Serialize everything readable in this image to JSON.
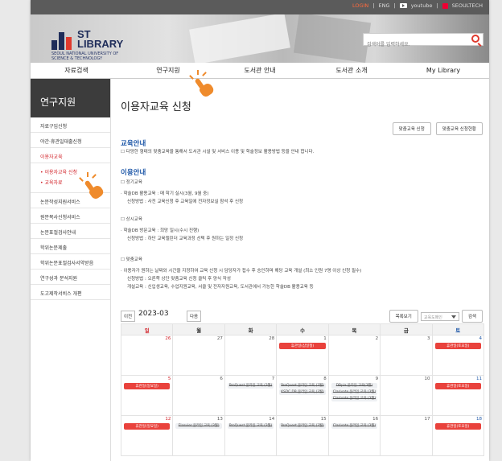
{
  "topbar": {
    "login": "LOGIN",
    "eng": "ENG",
    "youtube": "youtube",
    "seoultech": "SEOULTECH"
  },
  "logo": {
    "st": "ST",
    "library": "LIBRARY",
    "sub1": "SEOUL NATIONAL UNIVERSITY OF",
    "sub2": "SCIENCE & TECHNOLOGY"
  },
  "search": {
    "placeholder": "검색어를 입력하세요."
  },
  "nav": [
    "자료검색",
    "연구지원",
    "도서관 안내",
    "도서관 소개",
    "My Library"
  ],
  "sidebar": {
    "title": "연구지원",
    "items": [
      "자료구입신청",
      "야간·휴관일대출신청",
      "이용자교육"
    ],
    "subitems": [
      "이용자교육 신청",
      "교육자료"
    ],
    "items2": [
      "논문작성지원서비스",
      "원문복사신청서비스",
      "논문표절검사안내",
      "학위논문제출",
      "학위논문표절검사서약받음",
      "연구성과 분석지원",
      "도고제작서비스 개편"
    ]
  },
  "main": {
    "title": "이용자교육 신청",
    "buttons": [
      "맞춤교육 신청",
      "맞춤교육 신청현황"
    ],
    "edu_title": "교육안내",
    "edu_text": "☐ 다양한 형태의 맞춤교육을 통해서 도서관 시설 및 서비스 이용 및 학술정보 활용방법 등을 안내 합니다.",
    "use_title": "이용안내",
    "s1_head": "☐ 정기교육",
    "s1_l1": "· 학술DB 활용교육 : 매 학기 실시(3월, 9월 중)",
    "s1_l2": "신청방법 : 사전 교육신청 후 교육일에 전자정보실 참석 후 신청",
    "s2_head": "☐ 상시교육",
    "s2_l1": "· 학술DB 방문교육 : 희망 일시(수시 진행)",
    "s2_l2": "신청방법 : 하단 교육캘린더 교육과정 선택 후 원하는 일정 신청",
    "s3_head": "☐ 맞춤교육",
    "s3_l1": "· 이용자가 원하는 날짜와 시간을 지정하여 교육 신청 시 담당자가 접수 후 승인하며 해당 교육 개설 (최소 인원 7명 이상 신청 필수)",
    "s3_l2": "신청방법 : 오른쪽 상단 맞춤교육 신청 클릭 후 양식 작성",
    "s3_l3": "개설교육 : 신입생교육, 수업지원교육, 서클 및 전자자원교육, 도서관에서 가능한 학술DB 활용교육 등"
  },
  "calendar": {
    "prev": "이전",
    "month": "2023-03",
    "next": "다음",
    "today_btn": "목록보기",
    "select_placeholder": "교육도메인",
    "go_btn": "검색",
    "days": [
      "일",
      "월",
      "화",
      "수",
      "목",
      "금",
      "토"
    ],
    "weeks": [
      [
        {
          "d": "26",
          "ev": []
        },
        {
          "d": "27",
          "ev": []
        },
        {
          "d": "28",
          "ev": []
        },
        {
          "d": "1",
          "pill": "휴관일(삼일절)",
          "ev": []
        },
        {
          "d": "2",
          "ev": []
        },
        {
          "d": "3",
          "ev": []
        },
        {
          "d": "4",
          "pill": "휴관일(토요일)",
          "ev": []
        }
      ],
      [
        {
          "d": "5",
          "pill": "휴관일(일요일)",
          "ev": []
        },
        {
          "d": "6",
          "ev": []
        },
        {
          "d": "7",
          "ev": [
            "ProQuest 온라인 교육 (3월)"
          ]
        },
        {
          "d": "8",
          "ev": [
            "ProQuest 온라인 교육 (3월)",
            "KSDC DB 온라인 교육 (3월)"
          ]
        },
        {
          "d": "9",
          "ev": [
            "DBpia 온라인 교육(3월)",
            "Clarivate 온라인 교육 (3월)",
            "Clarivate 온라인 교육 (3월)"
          ]
        },
        {
          "d": "10",
          "ev": []
        },
        {
          "d": "11",
          "pill": "휴관일(토요일)",
          "ev": []
        }
      ],
      [
        {
          "d": "12",
          "pill": "휴관일(일요일)",
          "ev": []
        },
        {
          "d": "13",
          "ev": [
            "Elsevier 온라인 교육 (3월)"
          ]
        },
        {
          "d": "14",
          "ev": [
            "ProQuest 온라인 교육 (3월)"
          ]
        },
        {
          "d": "15",
          "ev": [
            "ProQuest 온라인 교육 (3월)"
          ]
        },
        {
          "d": "16",
          "ev": [
            "Clarivate 온라인 교육 (3월)"
          ]
        },
        {
          "d": "17",
          "ev": []
        },
        {
          "d": "18",
          "pill": "휴관일(토요일)",
          "ev": []
        }
      ]
    ]
  },
  "colors": {
    "accent": "#d2232a",
    "blue": "#1f58a8",
    "pill": "#e9423c",
    "hand": "#ef8b2c"
  }
}
